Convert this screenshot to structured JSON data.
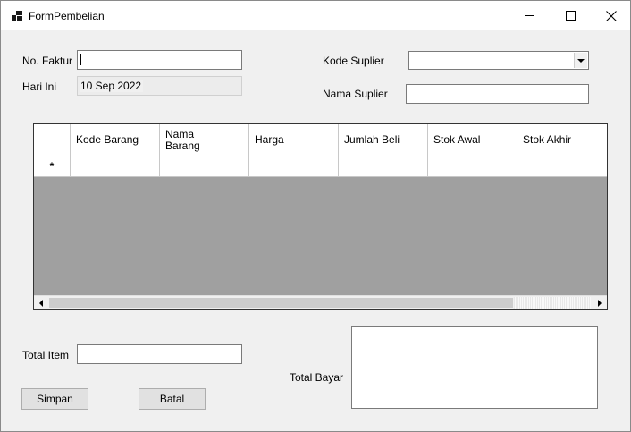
{
  "window": {
    "title": "FormPembelian"
  },
  "form": {
    "no_faktur_label": "No. Faktur",
    "no_faktur_value": "",
    "hari_ini_label": "Hari Ini",
    "hari_ini_value": "10 Sep 2022",
    "kode_suplier_label": "Kode Suplier",
    "kode_suplier_value": "",
    "nama_suplier_label": "Nama Suplier",
    "nama_suplier_value": "",
    "total_item_label": "Total Item",
    "total_item_value": "",
    "total_bayar_label": "Total Bayar",
    "total_bayar_value": ""
  },
  "grid": {
    "columns": [
      "Kode Barang",
      "Nama Barang",
      "Harga",
      "Jumlah Beli",
      "Stok Awal",
      "Stok Akhir"
    ],
    "new_row_marker": "*"
  },
  "buttons": {
    "simpan": "Simpan",
    "batal": "Batal"
  }
}
